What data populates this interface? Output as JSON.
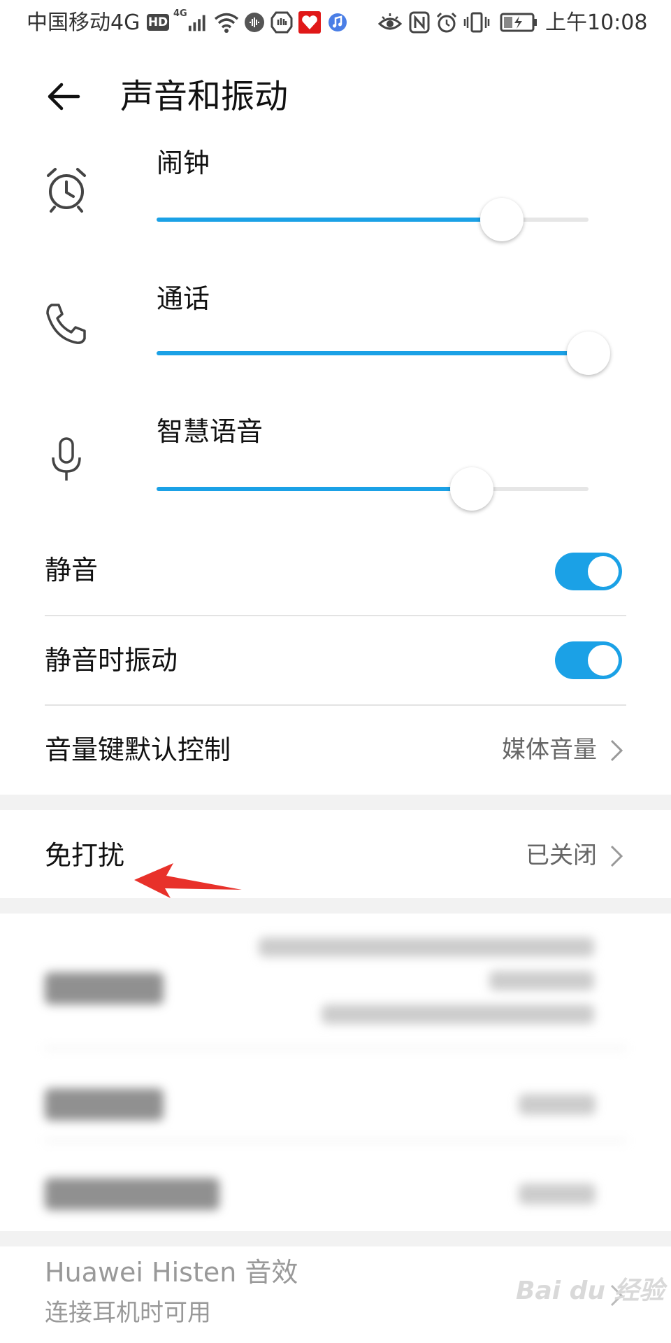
{
  "status_bar": {
    "carrier": "中国移动4G",
    "hd_badge": "HD",
    "network": "4G",
    "time": "上午10:08",
    "icons": [
      "hd-icon",
      "signal-icon",
      "wifi-icon",
      "audio-icon",
      "shield-icon",
      "app-red-icon",
      "music-icon",
      "eye-icon",
      "nfc-icon",
      "alarm-icon",
      "vibrate-icon",
      "battery-icon"
    ]
  },
  "header": {
    "back_icon": "arrow-left-icon",
    "title": "声音和振动"
  },
  "volumes": [
    {
      "label": "闹钟",
      "icon": "alarm-clock-icon",
      "level": 0.8
    },
    {
      "label": "通话",
      "icon": "phone-icon",
      "level": 1.0
    },
    {
      "label": "智慧语音",
      "icon": "microphone-icon",
      "level": 0.73
    }
  ],
  "settings": {
    "mute": {
      "label": "静音",
      "on": true
    },
    "vibrate_on_mute": {
      "label": "静音时振动",
      "on": true
    },
    "volume_key": {
      "label": "音量键默认控制",
      "value": "媒体音量"
    },
    "dnd": {
      "label": "免打扰",
      "value": "已关闭"
    }
  },
  "histen": {
    "label": "Huawei Histen 音效",
    "sub": "连接耳机时可用"
  },
  "watermark": "Bai du 经验",
  "colors": {
    "accent": "#1ba1e6",
    "arrow": "#e8312a"
  }
}
